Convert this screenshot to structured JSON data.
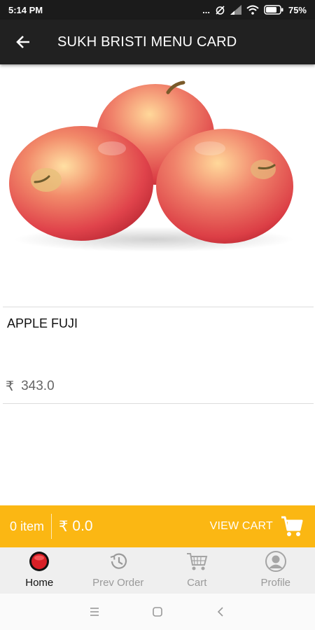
{
  "status_bar": {
    "time": "5:14 PM",
    "dots": "...",
    "battery": "75%",
    "icons": [
      "alarm-icon",
      "signal-icon",
      "wifi-icon",
      "battery-icon"
    ]
  },
  "app_bar": {
    "title": "SUKH BRISTI MENU CARD",
    "back_icon": "arrow-left-icon"
  },
  "product": {
    "image": "apples-photo",
    "name": "APPLE FUJI",
    "currency": "₹",
    "price": "343.0"
  },
  "cart_bar": {
    "count": "0 item",
    "currency": "₹",
    "total": "0.0",
    "view_cart": "VIEW CART",
    "icon": "shopping-cart-icon"
  },
  "bottom_nav": {
    "items": [
      {
        "label": "Home",
        "icon": "home-icon",
        "active": true
      },
      {
        "label": "Prev Order",
        "icon": "history-icon",
        "active": false
      },
      {
        "label": "Cart",
        "icon": "cart-icon",
        "active": false
      },
      {
        "label": "Profile",
        "icon": "profile-icon",
        "active": false
      }
    ]
  },
  "system_nav": {
    "icons": [
      "menu-icon",
      "home-square-icon",
      "back-chevron-icon"
    ]
  },
  "colors": {
    "app_bar": "#212121",
    "accent": "#fbb713",
    "nav_background": "#efefef",
    "active_label": "#111111",
    "inactive_label": "#9a9a9a"
  }
}
